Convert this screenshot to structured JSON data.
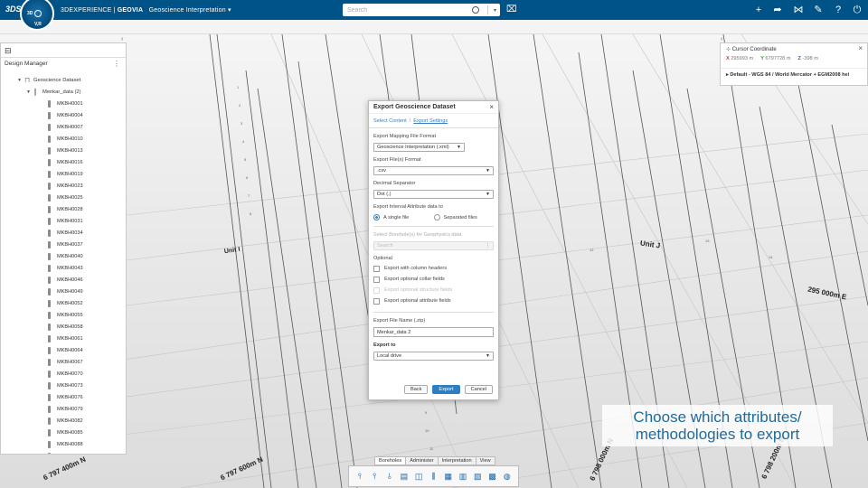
{
  "app": {
    "brand_light": "3DEXPERIENCE | ",
    "brand_bold": "GEOVIA",
    "app_name": "Geoscience Interpretation",
    "app_name_caret": "▾",
    "search_placeholder": "Search",
    "compass_labels": [
      "3D",
      "V,R"
    ],
    "top_icons": [
      "plus-icon",
      "share-icon",
      "network-icon",
      "tools-icon",
      "help-icon",
      "power-icon"
    ]
  },
  "left_panel": {
    "title": "Design Manager",
    "root": "Geoscience Dataset",
    "dataset": "Menkar_data (2)",
    "boreholes": [
      "MKBH0001",
      "MKBH0004",
      "MKBH0007",
      "MKBH0010",
      "MKBH0013",
      "MKBH0016",
      "MKBH0019",
      "MKBH0023",
      "MKBH0025",
      "MKBH0028",
      "MKBH0031",
      "MKBH0034",
      "MKBH0037",
      "MKBH0040",
      "MKBH0043",
      "MKBH0046",
      "MKBH0049",
      "MKBH0052",
      "MKBH0055",
      "MKBH0058",
      "MKBH0061",
      "MKBH0064",
      "MKBH0067",
      "MKBH0070",
      "MKBH0073",
      "MKBH0076",
      "MKBH0079",
      "MKBH0082",
      "MKBH0085",
      "MKBH0088",
      "MKBH0091"
    ]
  },
  "right_panel": {
    "title": "Cursor Coordinate",
    "x_label": "X",
    "x_value": "295993 m",
    "y_label": "Y",
    "y_value": "6797728 m",
    "z_label": "Z",
    "z_value": "-398 m",
    "crs": "Default - WGS 84 / World Mercator + EGM2008 hei"
  },
  "dialog": {
    "title": "Export Geoscience Dataset",
    "crumb_1": "Select Content",
    "crumb_sep": "\\",
    "crumb_2": "Export Settings",
    "mapping_label": "Export Mapping File Format",
    "mapping_value": "Geoscience Interpretation (.xml)",
    "file_format_label": "Export File(s) Format",
    "file_format_value": ".csv",
    "decimal_label": "Decimal Separator",
    "decimal_value": "Dot (.)",
    "interval_label": "Export Interval Attribute data to",
    "radio_single": "A single file",
    "radio_separated": "Separated files",
    "geophysics_label": "Select Borehole(s) for Geophysics data",
    "geophysics_placeholder": "Search",
    "optional_label": "Optional",
    "opt_headers": "Export with column headers",
    "opt_collar": "Export optional collar fields",
    "opt_structure": "Export optional structure fields",
    "opt_attribute": "Export optional attribute fields",
    "filename_label": "Export File Name (.zip)",
    "filename_value": "Menkar_data 2",
    "export_to_label": "Export to",
    "export_to_value": "Local drive",
    "btn_back": "Back",
    "btn_export": "Export",
    "btn_cancel": "Cancel"
  },
  "scene": {
    "label_unit_i": "Unit I",
    "label_unit_j": "Unit J",
    "label_e": "295 000m E",
    "label_n1": "6 797 400m N",
    "label_n2": "6 797 600m N",
    "label_n3": "6 798 000m N",
    "label_n4": "6 798 200m N"
  },
  "bottom_toolbar": {
    "tabs": [
      "Boreholes",
      "Administer",
      "Interpretation",
      "View"
    ],
    "icons": [
      "borehole-add-icon",
      "borehole-edit-icon",
      "borehole-import-icon",
      "log-icon",
      "chart-icon",
      "section-icon",
      "grid-icon",
      "strip-icon",
      "layers-icon",
      "table-icon",
      "globe-icon"
    ]
  },
  "caption": {
    "line1": "Choose which attributes/",
    "line2": "methodologies to export"
  },
  "colors": {
    "topbar": "#005386",
    "accent": "#2d7fc2",
    "caption_text": "#1f6a9a"
  }
}
